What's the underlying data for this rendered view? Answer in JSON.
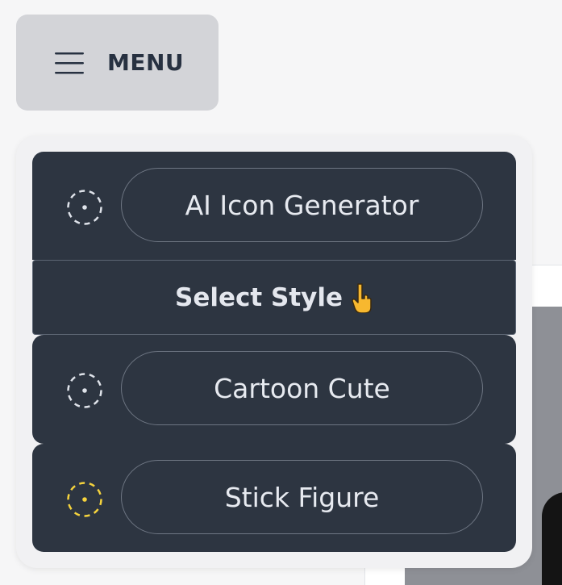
{
  "menu": {
    "label": "MENU",
    "icon": "hamburger-icon"
  },
  "dropdown": {
    "items": [
      {
        "label": "AI Icon Generator",
        "icon": "dashed-circle-icon",
        "icon_color": "#dfe3ea"
      },
      {
        "label": "Cartoon Cute",
        "icon": "dashed-circle-icon",
        "icon_color": "#dfe3ea"
      },
      {
        "label": "Stick Figure",
        "icon": "dashed-circle-icon",
        "icon_color": "#f5d33d"
      }
    ],
    "section_header": {
      "label": "Select Style",
      "icon": "pointing-down-hand-icon"
    }
  },
  "colors": {
    "panel_bg": "#2d3541",
    "menu_button_bg": "#d3d4d8",
    "accent_selected": "#f5d33d"
  }
}
